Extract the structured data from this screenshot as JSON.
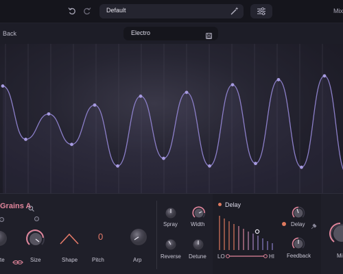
{
  "topbar": {
    "undo_icon": "undo-icon",
    "redo_icon": "redo-icon",
    "preset_name": "Default",
    "wand_icon": "magic-wand-icon",
    "settings_icon": "sliders-icon",
    "mix_label": "Mix"
  },
  "subbar": {
    "back_label": "Back",
    "style_name": "Electro",
    "save_icon": "save-icon"
  },
  "waveform": {
    "line_color": "#8c7fc9",
    "peak_values": [
      0.75,
      0.33,
      0.53,
      0.29,
      0.6,
      0.12,
      0.67,
      0.18,
      0.7,
      0.12,
      0.76,
      0.14,
      0.8,
      0.11,
      0.83,
      0.05,
      0.89,
      0.1
    ]
  },
  "grains": {
    "title": "Grains A",
    "knobs": [
      {
        "label": "te"
      },
      {
        "label": "Size"
      },
      {
        "label": "Shape"
      },
      {
        "label": "Pitch",
        "value": "0"
      },
      {
        "label": "Arp"
      },
      {
        "label": "Spray"
      },
      {
        "label": "Width"
      },
      {
        "label": "Reverse"
      },
      {
        "label": "Detune"
      }
    ]
  },
  "delay": {
    "title": "Delay",
    "lo_label": "LO",
    "hi_label": "HI",
    "knobs": [
      {
        "label": "Delay"
      },
      {
        "label": "Feedback"
      }
    ]
  },
  "mix": {
    "label": "Mi"
  },
  "colors": {
    "accent": "#e2869c",
    "orange": "#e67b6a",
    "purple": "#8c7fc9",
    "background": "#1b1b24"
  }
}
